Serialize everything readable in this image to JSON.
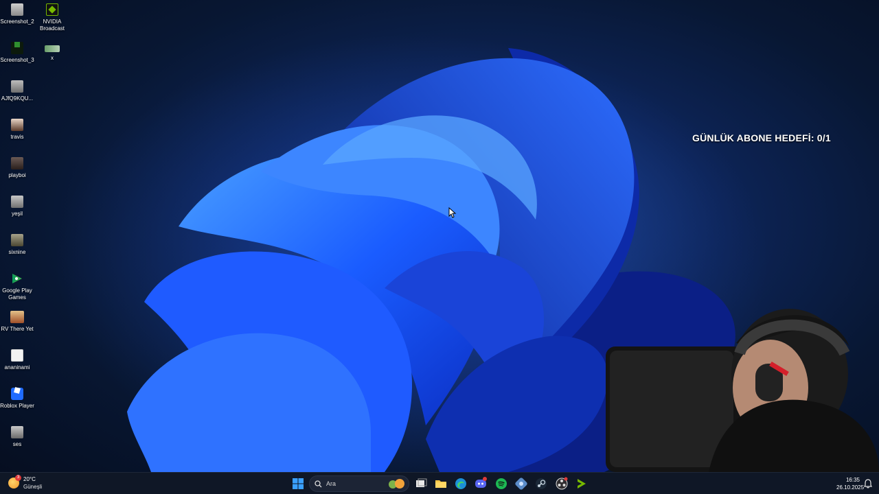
{
  "desktop": {
    "icons": [
      {
        "label": "Screenshot_2",
        "type": "photo"
      },
      {
        "label": "NVIDIA\nBroadcast",
        "type": "nvidia"
      },
      {
        "label": "Screenshot_3",
        "type": "nvidia-dark"
      },
      {
        "label": "x",
        "type": "image"
      },
      {
        "label": "AJfQ9KQU...",
        "type": "photo"
      },
      {
        "label": "travis",
        "type": "photo"
      },
      {
        "label": "playboi",
        "type": "photo"
      },
      {
        "label": "yeşil",
        "type": "photo"
      },
      {
        "label": "sixnine",
        "type": "photo"
      },
      {
        "label": "Google Play\nGames",
        "type": "play"
      },
      {
        "label": "RV There Yet",
        "type": "game"
      },
      {
        "label": "ananinami",
        "type": "doc"
      },
      {
        "label": "Roblox Player",
        "type": "roblox"
      },
      {
        "label": "ses",
        "type": "photo"
      }
    ],
    "overlay_goal": "GÜNLÜK ABONE HEDEFİ: 0/1"
  },
  "taskbar": {
    "weather": {
      "temp": "20°C",
      "condition": "Güneşli",
      "badge": "3"
    },
    "search_placeholder": "Ara",
    "apps": [
      "start-icon",
      "search-icon",
      "task-view-icon",
      "file-explorer-icon",
      "edge-icon",
      "discord-icon",
      "spotify-icon",
      "app-icon",
      "steam-icon",
      "obs-icon",
      "nvidia-icon"
    ],
    "clock": {
      "time": "16:35",
      "date": "26.10.2025"
    }
  },
  "colors": {
    "accent": "#1a5cff",
    "taskbar": "#0f1726"
  }
}
